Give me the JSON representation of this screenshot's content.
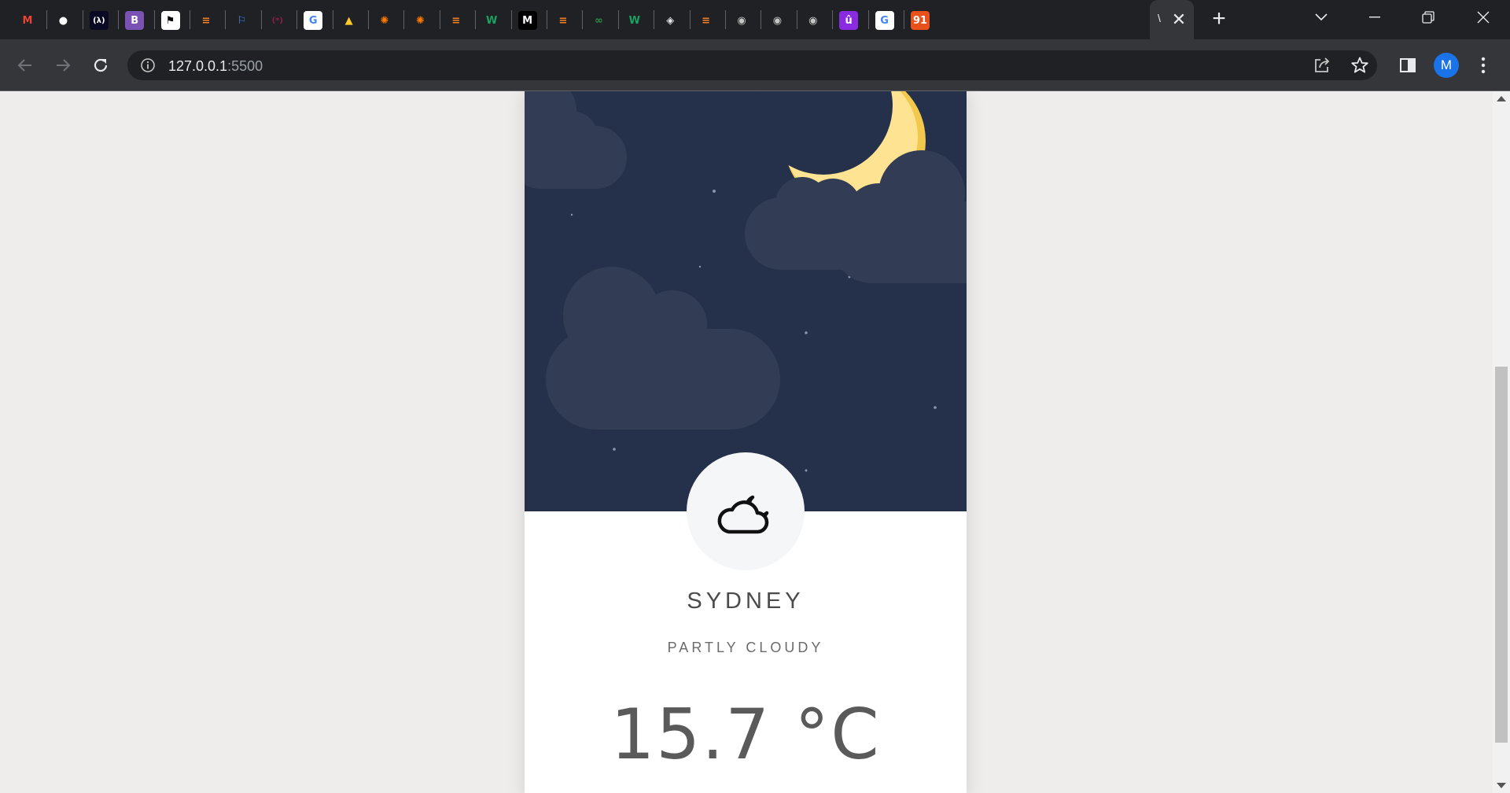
{
  "browser": {
    "tabs": [
      {
        "name": "gmail",
        "glyph": "M",
        "color": "#ea4335",
        "bg": "transparent"
      },
      {
        "name": "github",
        "glyph": "●",
        "color": "#ffffff",
        "bg": "transparent"
      },
      {
        "name": "freecodecamp",
        "glyph": "(λ)",
        "color": "#ffffff",
        "bg": "#0a0a23"
      },
      {
        "name": "bootstrap",
        "glyph": "B",
        "color": "#ffffff",
        "bg": "#7952b3"
      },
      {
        "name": "flag-site",
        "glyph": "⚑",
        "color": "#000000",
        "bg": "#ffffff"
      },
      {
        "name": "stackoverflow",
        "glyph": "≡",
        "color": "#f48024",
        "bg": "transparent"
      },
      {
        "name": "flag-blue",
        "glyph": "⚐",
        "color": "#4c8bf5",
        "bg": "transparent"
      },
      {
        "name": "regex-site",
        "glyph": "(*)",
        "color": "#8a1f4a",
        "bg": "transparent"
      },
      {
        "name": "google",
        "glyph": "G",
        "color": "#4285f4",
        "bg": "#ffffff"
      },
      {
        "name": "firebase",
        "glyph": "▲",
        "color": "#ffca28",
        "bg": "transparent"
      },
      {
        "name": "orange-sun-1",
        "glyph": "✺",
        "color": "#ff7a00",
        "bg": "transparent"
      },
      {
        "name": "orange-sun-2",
        "glyph": "✺",
        "color": "#ff7a00",
        "bg": "transparent"
      },
      {
        "name": "stackoverflow-2",
        "glyph": "≡",
        "color": "#f48024",
        "bg": "transparent"
      },
      {
        "name": "w-green-1",
        "glyph": "W",
        "color": "#1aa260",
        "bg": "transparent"
      },
      {
        "name": "m-site",
        "glyph": "M",
        "color": "#ffffff",
        "bg": "#000000"
      },
      {
        "name": "stackoverflow-3",
        "glyph": "≡",
        "color": "#f48024",
        "bg": "transparent"
      },
      {
        "name": "gfg",
        "glyph": "∞",
        "color": "#2f8d46",
        "bg": "transparent"
      },
      {
        "name": "w-green-2",
        "glyph": "W",
        "color": "#1aa260",
        "bg": "transparent"
      },
      {
        "name": "cube-site",
        "glyph": "◈",
        "color": "#e8eaed",
        "bg": "transparent"
      },
      {
        "name": "stackoverflow-4",
        "glyph": "≡",
        "color": "#f48024",
        "bg": "transparent"
      },
      {
        "name": "globe-1",
        "glyph": "◉",
        "color": "#c4c7c5",
        "bg": "transparent"
      },
      {
        "name": "globe-2",
        "glyph": "◉",
        "color": "#c4c7c5",
        "bg": "transparent"
      },
      {
        "name": "globe-3",
        "glyph": "◉",
        "color": "#c4c7c5",
        "bg": "transparent"
      },
      {
        "name": "ublock",
        "glyph": "û",
        "color": "#ffffff",
        "bg": "#8a2be2"
      },
      {
        "name": "google-2",
        "glyph": "G",
        "color": "#4285f4",
        "bg": "#ffffff"
      },
      {
        "name": "91-site",
        "glyph": "91",
        "color": "#ffffff",
        "bg": "#e8501c"
      }
    ],
    "active_tab_title": "\\",
    "new_tab_label": "+",
    "url_host": "127.0.0.1",
    "url_port": ":5500",
    "profile_initial": "M"
  },
  "weather": {
    "city": "SYDNEY",
    "condition": "PARTLY CLOUDY",
    "temperature": "15.7 °C",
    "condition_icon": "cloud-moon-icon"
  },
  "colors": {
    "sky": "#25304a",
    "cloud": "#323d55",
    "moon": "#fde392",
    "moon_shade": "#f2c94c",
    "star": "#8a94aa"
  }
}
